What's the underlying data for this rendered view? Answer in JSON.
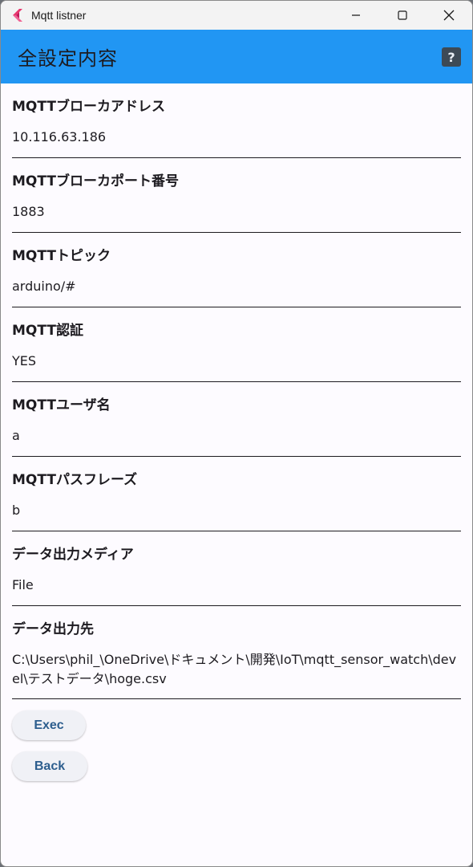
{
  "window": {
    "title": "Mqtt listner",
    "icons": {
      "app": "flutter-icon",
      "minimize": "minimize-icon",
      "maximize": "maximize-icon",
      "close": "close-icon"
    }
  },
  "appbar": {
    "title": "全設定内容",
    "help_label": "?",
    "color": "#2196f3"
  },
  "fields": [
    {
      "label": "MQTTブローカアドレス",
      "value": "10.116.63.186"
    },
    {
      "label": "MQTTブローカポート番号",
      "value": "1883"
    },
    {
      "label": "MQTTトピック",
      "value": "arduino/#"
    },
    {
      "label": "MQTT認証",
      "value": "YES"
    },
    {
      "label": "MQTTユーザ名",
      "value": "a"
    },
    {
      "label": "MQTTパスフレーズ",
      "value": "b"
    },
    {
      "label": "データ出力メディア",
      "value": "File"
    },
    {
      "label": "データ出力先",
      "value": "C:\\Users\\phil_\\OneDrive\\ドキュメント\\開発\\IoT\\mqtt_sensor_watch\\devel\\テストデータ\\hoge.csv"
    }
  ],
  "buttons": {
    "exec_label": "Exec",
    "back_label": "Back"
  }
}
